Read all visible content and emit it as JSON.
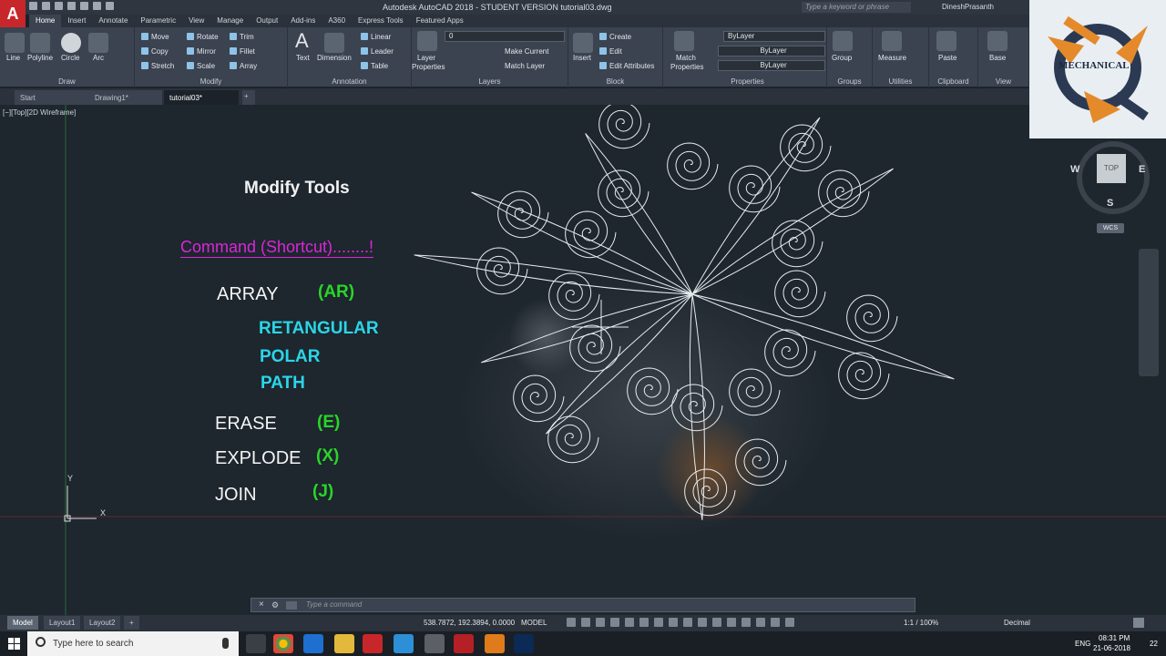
{
  "titlebar": {
    "app_logo": "A",
    "title": "Autodesk AutoCAD 2018 - STUDENT VERSION   tutorial03.dwg",
    "search_placeholder": "Type a keyword or phrase",
    "user": "DineshPrasanth"
  },
  "ribbon": {
    "tabs": [
      "Home",
      "Insert",
      "Annotate",
      "Parametric",
      "View",
      "Manage",
      "Output",
      "Add-ins",
      "A360",
      "Express Tools",
      "Featured Apps"
    ],
    "active_tab": "Home",
    "draw": {
      "title": "Draw",
      "line": "Line",
      "polyline": "Polyline",
      "circle": "Circle",
      "arc": "Arc"
    },
    "modify": {
      "title": "Modify",
      "move": "Move",
      "rotate": "Rotate",
      "trim": "Trim",
      "copy": "Copy",
      "mirror": "Mirror",
      "fillet": "Fillet",
      "stretch": "Stretch",
      "scale": "Scale",
      "array": "Array"
    },
    "annotation": {
      "title": "Annotation",
      "text": "Text",
      "dimension": "Dimension",
      "linear": "Linear",
      "leader": "Leader",
      "table": "Table"
    },
    "layers": {
      "title": "Layers",
      "layer_properties_1": "Layer",
      "layer_properties_2": "Properties",
      "current_layer": "0",
      "make_current": "Make Current",
      "match_layer": "Match Layer"
    },
    "block": {
      "title": "Block",
      "insert": "Insert",
      "create": "Create",
      "edit": "Edit",
      "edit_attributes": "Edit Attributes"
    },
    "properties": {
      "title": "Properties",
      "match_1": "Match",
      "match_2": "Properties",
      "color": "ByLayer",
      "linetype": "ByLayer",
      "lineweight": "ByLayer"
    },
    "groups": {
      "title": "Groups",
      "group": "Group"
    },
    "utilities": {
      "title": "Utilities",
      "measure": "Measure"
    },
    "clipboard": {
      "title": "Clipboard",
      "paste": "Paste"
    },
    "view": {
      "title": "View",
      "base": "Base"
    }
  },
  "doc_tabs": [
    "Start",
    "Drawing1*",
    "tutorial03*"
  ],
  "viewport": {
    "label": "[−][Top][2D Wireframe]",
    "ucs_y": "Y",
    "ucs_x": "X"
  },
  "lesson": {
    "title": "Modify Tools",
    "command_header": "Command  (Shortcut)........!",
    "commands": [
      {
        "name": "ARRAY",
        "shortcut": "(AR)"
      },
      {
        "name": "ERASE",
        "shortcut": "(E)"
      },
      {
        "name": "EXPLODE",
        "shortcut": "(X)"
      },
      {
        "name": "JOIN",
        "shortcut": "(J)"
      }
    ],
    "array_options": [
      "RETANGULAR",
      "POLAR",
      "PATH"
    ]
  },
  "viewcube": {
    "n": "N",
    "s": "S",
    "e": "E",
    "w": "W",
    "top": "TOP",
    "wcs": "WCS"
  },
  "watermark": {
    "text": "MECHANICAL"
  },
  "command_line": {
    "placeholder": "Type a command"
  },
  "status": {
    "layouts": [
      "Model",
      "Layout1",
      "Layout2"
    ],
    "coords": "538.7872, 192.3894, 0.0000",
    "mode": "MODEL",
    "scale": "1:1 / 100%",
    "units": "Decimal"
  },
  "taskbar": {
    "search_placeholder": "Type here to search",
    "language": "ENG",
    "time": "08:31 PM",
    "date": "21-06-2018",
    "notifications": "22"
  },
  "colors": {
    "command_header": "#d927d9",
    "shortcut": "#28d628",
    "array_option": "#2ad6e8",
    "autocad_red": "#c7272b"
  }
}
